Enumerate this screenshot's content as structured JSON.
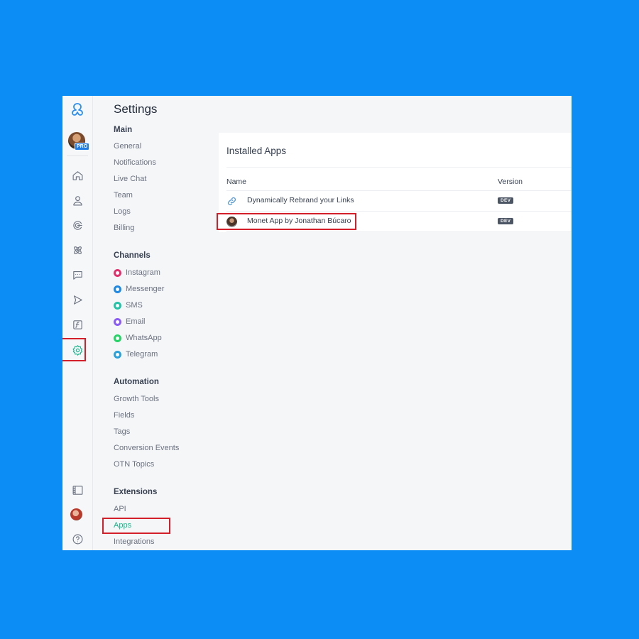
{
  "sidebar_title": "Settings",
  "sections": {
    "main": {
      "title": "Main",
      "items": [
        "General",
        "Notifications",
        "Live Chat",
        "Team",
        "Logs",
        "Billing"
      ]
    },
    "channels": {
      "title": "Channels",
      "items": [
        {
          "label": "Instagram",
          "icon": "instagram-icon",
          "color": "#e1306c"
        },
        {
          "label": "Messenger",
          "icon": "messenger-icon",
          "color": "#1e88e5"
        },
        {
          "label": "SMS",
          "icon": "sms-icon",
          "color": "#22c3a6"
        },
        {
          "label": "Email",
          "icon": "email-icon",
          "color": "#8b5cf6"
        },
        {
          "label": "WhatsApp",
          "icon": "whatsapp-icon",
          "color": "#25d366"
        },
        {
          "label": "Telegram",
          "icon": "telegram-icon",
          "color": "#2aa1da"
        }
      ]
    },
    "automation": {
      "title": "Automation",
      "items": [
        "Growth Tools",
        "Fields",
        "Tags",
        "Conversion Events",
        "OTN Topics"
      ]
    },
    "extensions": {
      "title": "Extensions",
      "items": [
        "API",
        "Apps",
        "Integrations"
      ]
    }
  },
  "account": {
    "badge": "PRO"
  },
  "installed_apps": {
    "title": "Installed Apps",
    "columns": [
      "Name",
      "Version"
    ],
    "rows": [
      {
        "name": "Dynamically Rebrand your Links",
        "version": "DEV",
        "icon": "link-icon"
      },
      {
        "name": "Monet App by Jonathan Búcaro",
        "version": "DEV",
        "icon": "avatar"
      }
    ]
  },
  "colors": {
    "accent": "#16b58a",
    "highlight": "#d21f2a",
    "background": "#0b8df5"
  }
}
